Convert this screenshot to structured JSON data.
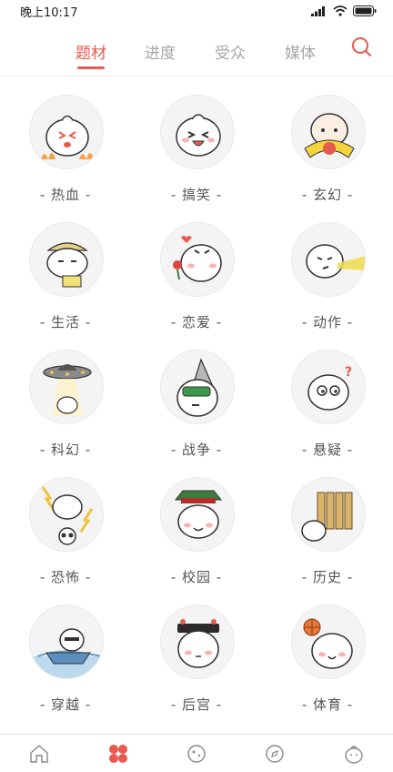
{
  "status_bar": {
    "time": "晚上10:17"
  },
  "tabs": [
    {
      "label": "题材",
      "active": true
    },
    {
      "label": "进度",
      "active": false
    },
    {
      "label": "受众",
      "active": false
    },
    {
      "label": "媒体",
      "active": false
    }
  ],
  "search_icon": "search-icon",
  "accent_color": "#e8594f",
  "genres": [
    {
      "label": "- 热血 -"
    },
    {
      "label": "- 搞笑 -"
    },
    {
      "label": "- 玄幻 -"
    },
    {
      "label": "- 生活 -"
    },
    {
      "label": "- 恋爱 -"
    },
    {
      "label": "- 动作 -"
    },
    {
      "label": "- 科幻 -"
    },
    {
      "label": "- 战争 -"
    },
    {
      "label": "- 悬疑 -"
    },
    {
      "label": "- 恐怖 -"
    },
    {
      "label": "- 校园 -"
    },
    {
      "label": "- 历史 -"
    },
    {
      "label": "- 穿越 -"
    },
    {
      "label": "- 后宫 -"
    },
    {
      "label": "- 体育 -"
    }
  ],
  "bottom_nav": [
    {
      "icon": "home-icon",
      "active": false
    },
    {
      "icon": "category-icon",
      "active": true
    },
    {
      "icon": "planet-icon",
      "active": false
    },
    {
      "icon": "compass-icon",
      "active": false
    },
    {
      "icon": "profile-icon",
      "active": false
    }
  ]
}
